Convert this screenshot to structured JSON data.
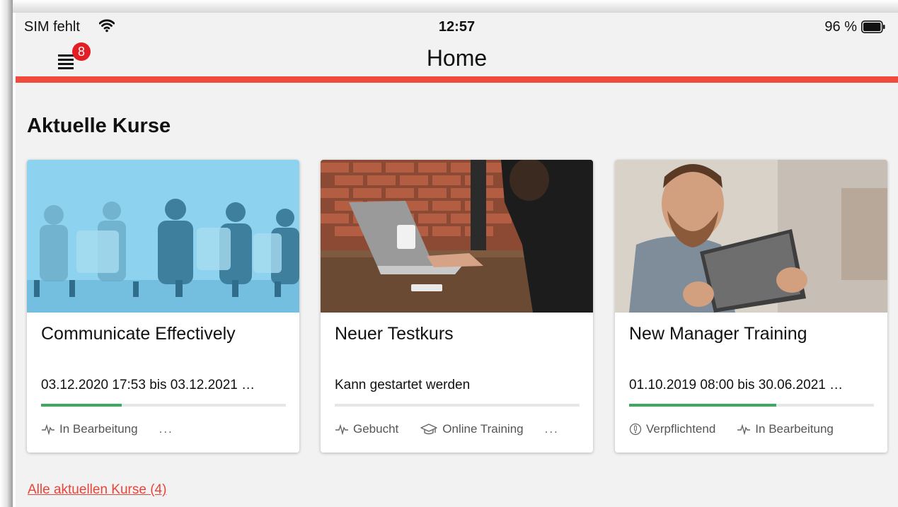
{
  "status_bar": {
    "carrier": "SIM fehlt",
    "time": "12:57",
    "battery_percent": "96 %"
  },
  "nav": {
    "title": "Home",
    "menu_badge": "8"
  },
  "section": {
    "title": "Aktuelle Kurse"
  },
  "cards": [
    {
      "title": "Communicate Effectively",
      "date": "03.12.2020 17:53 bis 03.12.2021 …",
      "progress": 0.33,
      "tags": [
        {
          "icon": "activity-icon",
          "label": "In Bearbeitung"
        }
      ],
      "more": "..."
    },
    {
      "title": "Neuer Testkurs",
      "date": "Kann gestartet werden",
      "progress": 0,
      "tags": [
        {
          "icon": "activity-icon",
          "label": "Gebucht"
        },
        {
          "icon": "graduation-cap-icon",
          "label": "Online Training"
        }
      ],
      "more": "..."
    },
    {
      "title": "New Manager Training",
      "date": "01.10.2019 08:00 bis 30.06.2021 …",
      "progress": 0.6,
      "tags": [
        {
          "icon": "alert-circle-icon",
          "label": "Verpflichtend"
        },
        {
          "icon": "activity-icon",
          "label": "In Bearbeitung"
        }
      ]
    }
  ],
  "footer_link": "Alle aktuellen Kurse (4)",
  "colors": {
    "accent": "#f04a3c",
    "badge": "#e31e24",
    "progress": "#3aaa5c",
    "link": "#e8453a"
  }
}
